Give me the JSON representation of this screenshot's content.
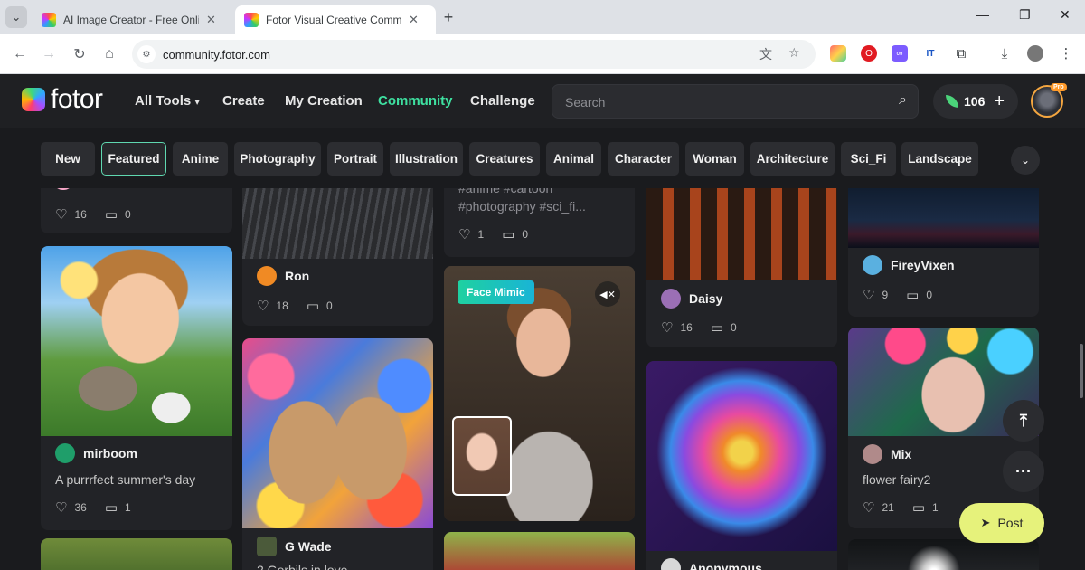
{
  "browser": {
    "tabs": [
      {
        "title": "AI Image Creator - Free Online",
        "active": false
      },
      {
        "title": "Fotor Visual Creative Community",
        "active": true
      }
    ],
    "new_tab": "+",
    "url": "community.fotor.com"
  },
  "header": {
    "logo": "fotor",
    "nav": [
      "All Tools",
      "Create",
      "My Creation",
      "Community",
      "Challenge"
    ],
    "active_nav": "Community",
    "search_placeholder": "Search",
    "credits": "106",
    "pro_badge": "Pro"
  },
  "categories": {
    "items": [
      "New",
      "Featured",
      "Anime",
      "Photography",
      "Portrait",
      "Illustration",
      "Creatures",
      "Animal",
      "Character",
      "Woman",
      "Architecture",
      "Sci_Fi",
      "Landscape"
    ],
    "selected": "Featured"
  },
  "feed": {
    "cards": [
      {
        "stats": {
          "likes": "16",
          "comments": "0"
        }
      },
      {
        "author": "mirboom",
        "caption": "A purrrfect summer's day",
        "stats": {
          "likes": "36",
          "comments": "1"
        }
      },
      {
        "author": "Ron",
        "stats": {
          "likes": "18",
          "comments": "0"
        }
      },
      {
        "author": "G Wade",
        "caption": "2 Gerbils in love"
      },
      {
        "tags": "#anime #cartoon",
        "tags2": "#photography #sci_fi...",
        "stats": {
          "likes": "1",
          "comments": "0"
        }
      },
      {
        "badge": "Face Mimic"
      },
      {
        "author": "Daisy",
        "stats": {
          "likes": "16",
          "comments": "0"
        }
      },
      {
        "author": "Anonymous"
      },
      {
        "author": "FireyVixen",
        "stats": {
          "likes": "9",
          "comments": "0"
        }
      },
      {
        "author": "Mix",
        "caption": "flower fairy2",
        "stats": {
          "likes": "21",
          "comments": "1"
        }
      }
    ]
  },
  "actions": {
    "post_label": "Post"
  },
  "colors": {
    "accent": "#3ee0a0",
    "post_bg": "#e6f27b",
    "background": "#1a1b1e"
  }
}
